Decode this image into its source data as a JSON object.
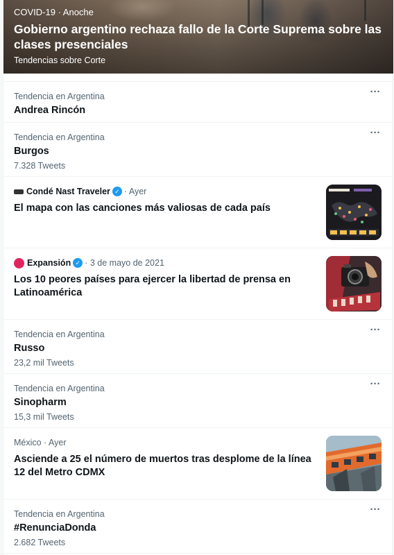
{
  "hero": {
    "meta": "COVID-19 · Anoche",
    "title": "Gobierno argentino rechaza fallo de la Corte Suprema sobre las clases presenciales",
    "subtitle": "Tendencias sobre Corte"
  },
  "items": [
    {
      "kind": "trend",
      "meta": "Tendencia en Argentina",
      "title": "Andrea Rincón",
      "count": ""
    },
    {
      "kind": "trend",
      "meta": "Tendencia en Argentina",
      "title": "Burgos",
      "count": "7.328 Tweets"
    },
    {
      "kind": "news",
      "source": "Condé Nast Traveler",
      "time": "· Ayer",
      "title": "El mapa con las canciones más valiosas de cada país",
      "verified": true
    },
    {
      "kind": "news",
      "source": "Expansión",
      "time": "· 3 de mayo de 2021",
      "title": "Los 10 peores países para ejercer la libertad de prensa en Latinoamérica",
      "verified": true
    },
    {
      "kind": "trend",
      "meta": "Tendencia en Argentina",
      "title": "Russo",
      "count": "23,2 mil Tweets"
    },
    {
      "kind": "trend",
      "meta": "Tendencia en Argentina",
      "title": "Sinopharm",
      "count": "15,3 mil Tweets"
    },
    {
      "kind": "news",
      "meta": "México · Ayer",
      "title": "Asciende a 25 el número de muertos tras desplome de la línea 12 del Metro CDMX"
    },
    {
      "kind": "trend",
      "meta": "Tendencia en Argentina",
      "title": "#RenunciaDonda",
      "count": "2.682 Tweets"
    }
  ],
  "icons": {
    "more": "more-horizontal-icon",
    "verified": "verified-badge-icon"
  },
  "colors": {
    "accent": "#1d9bf0",
    "secondary_text": "#536471",
    "expansion_logo": "#e0245e"
  }
}
